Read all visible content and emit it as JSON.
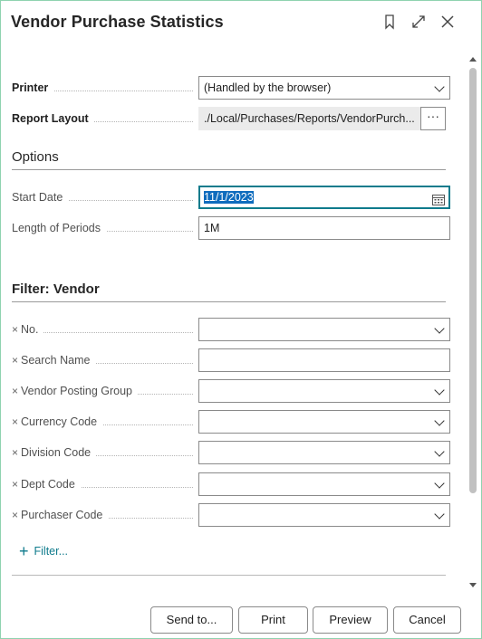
{
  "title": "Vendor Purchase Statistics",
  "title_icons": [
    "bookmark-icon",
    "expand-icon",
    "close-icon"
  ],
  "printer": {
    "label": "Printer",
    "value": "(Handled by the browser)"
  },
  "report_layout": {
    "label": "Report Layout",
    "value": "./Local/Purchases/Reports/VendorPurch...",
    "more": "···"
  },
  "options": {
    "heading": "Options",
    "start_date": {
      "label": "Start Date",
      "value": "11/1/2023"
    },
    "length_of_periods": {
      "label": "Length of Periods",
      "value": "1M"
    }
  },
  "filter_vendor": {
    "heading": "Filter: Vendor",
    "remove_glyph": "×",
    "fields": [
      {
        "label": "No.",
        "value": ""
      },
      {
        "label": "Search Name",
        "value": ""
      },
      {
        "label": "Vendor Posting Group",
        "value": ""
      },
      {
        "label": "Currency Code",
        "value": ""
      },
      {
        "label": "Division Code",
        "value": ""
      },
      {
        "label": "Dept Code",
        "value": ""
      },
      {
        "label": "Purchaser Code",
        "value": ""
      }
    ],
    "add_filter": "Filter...",
    "add_glyph": "+"
  },
  "footer": {
    "send_to": "Send to...",
    "print": "Print",
    "preview": "Preview",
    "cancel": "Cancel"
  },
  "colors": {
    "accent": "#0f7b8c",
    "selection": "#0f6cbd",
    "border": "#8fd3b0"
  }
}
